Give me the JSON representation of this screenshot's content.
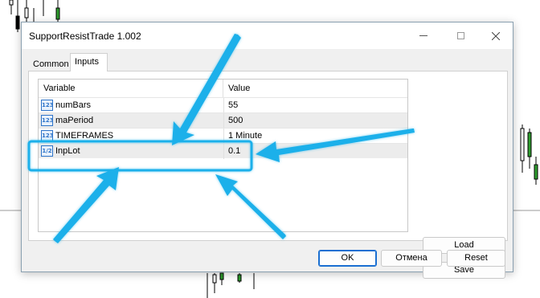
{
  "window": {
    "title": "SupportResistTrade 1.002"
  },
  "tabs": [
    {
      "label": "Common",
      "active": false
    },
    {
      "label": "Inputs",
      "active": true
    }
  ],
  "table": {
    "headers": {
      "variable": "Variable",
      "value": "Value"
    },
    "rows": [
      {
        "type_icon": "123",
        "name": "numBars",
        "value": "55"
      },
      {
        "type_icon": "123",
        "name": "maPeriod",
        "value": "500"
      },
      {
        "type_icon": "123",
        "name": "TIMEFRAMES",
        "value": "1 Minute"
      },
      {
        "type_icon": "1/2",
        "name": "InpLot",
        "value": "0.1"
      }
    ]
  },
  "buttons": {
    "load": "Load",
    "save": "Save",
    "ok": "OK",
    "cancel": "Отмена",
    "reset": "Reset"
  },
  "annotation": {
    "highlight_color": "#1ab0ea",
    "highlighted_row": "InpLot"
  },
  "icons": {
    "minimize": "minimize-icon",
    "maximize": "maximize-icon",
    "close": "close-icon",
    "integer_type": "integer-type-icon",
    "double_type": "double-type-icon"
  }
}
